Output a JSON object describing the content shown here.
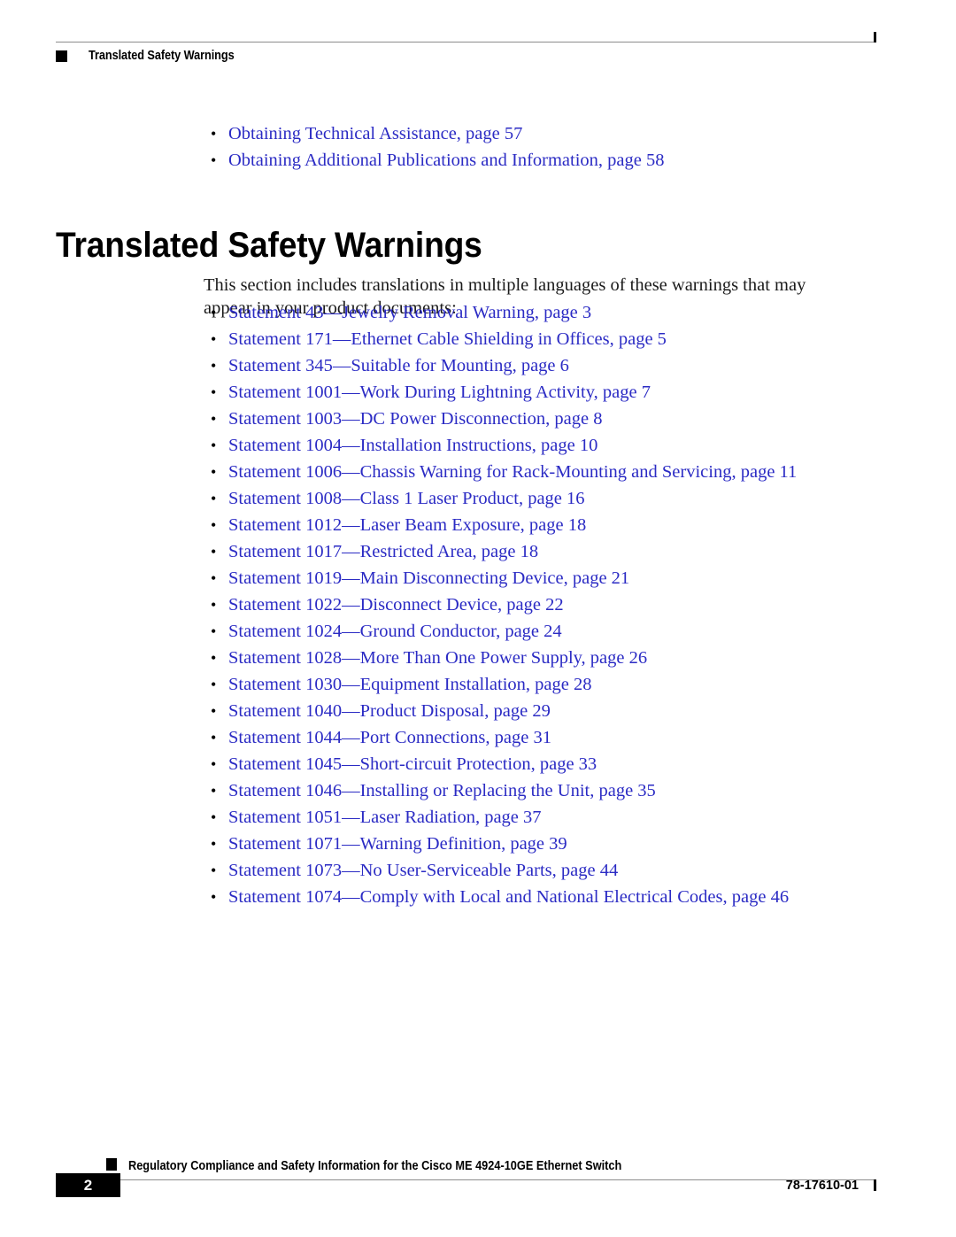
{
  "header": {
    "running_title": "Translated Safety Warnings",
    "square_icon": "black-square-icon"
  },
  "top_links": [
    {
      "text": "Obtaining Technical Assistance, page 57"
    },
    {
      "text": "Obtaining Additional Publications and Information, page 58"
    }
  ],
  "heading": "Translated Safety Warnings",
  "intro": "This section includes translations in multiple languages of these warnings that may appear in your product documents:",
  "statements": [
    {
      "text": "Statement 43—Jewelry Removal Warning, page 3"
    },
    {
      "text": "Statement 171—Ethernet Cable Shielding in Offices, page 5"
    },
    {
      "text": "Statement 345—Suitable for Mounting, page 6"
    },
    {
      "text": "Statement 1001—Work During Lightning Activity, page 7"
    },
    {
      "text": "Statement 1003—DC Power Disconnection, page 8"
    },
    {
      "text": "Statement 1004—Installation Instructions, page 10"
    },
    {
      "text": "Statement 1006—Chassis Warning for Rack-Mounting and Servicing, page 11"
    },
    {
      "text": "Statement 1008—Class 1 Laser Product, page 16"
    },
    {
      "text": "Statement 1012—Laser Beam Exposure, page 18"
    },
    {
      "text": "Statement 1017—Restricted Area, page 18"
    },
    {
      "text": "Statement 1019—Main Disconnecting Device, page 21"
    },
    {
      "text": "Statement 1022—Disconnect Device, page 22"
    },
    {
      "text": "Statement 1024—Ground Conductor, page 24"
    },
    {
      "text": "Statement 1028—More Than One Power Supply, page 26"
    },
    {
      "text": "Statement 1030—Equipment Installation, page 28"
    },
    {
      "text": "Statement 1040—Product Disposal, page 29"
    },
    {
      "text": "Statement 1044—Port Connections, page 31"
    },
    {
      "text": "Statement 1045—Short-circuit Protection, page 33"
    },
    {
      "text": "Statement 1046—Installing or Replacing the Unit, page 35"
    },
    {
      "text": "Statement 1051—Laser Radiation, page 37"
    },
    {
      "text": "Statement 1071—Warning Definition, page 39"
    },
    {
      "text": "Statement 1073—No User-Serviceable Parts, page 44"
    },
    {
      "text": "Statement 1074—Comply with Local and National Electrical Codes, page 46"
    }
  ],
  "bullet_glyph": "•",
  "footer": {
    "document_title": "Regulatory Compliance and Safety Information for the Cisco ME 4924-10GE Ethernet Switch",
    "page_number": "2",
    "doc_number": "78-17610-01",
    "square_icon": "black-square-icon"
  },
  "colors": {
    "link_blue": "#2b2bc4",
    "rule_gray": "#8c8c8c",
    "black": "#000000"
  }
}
